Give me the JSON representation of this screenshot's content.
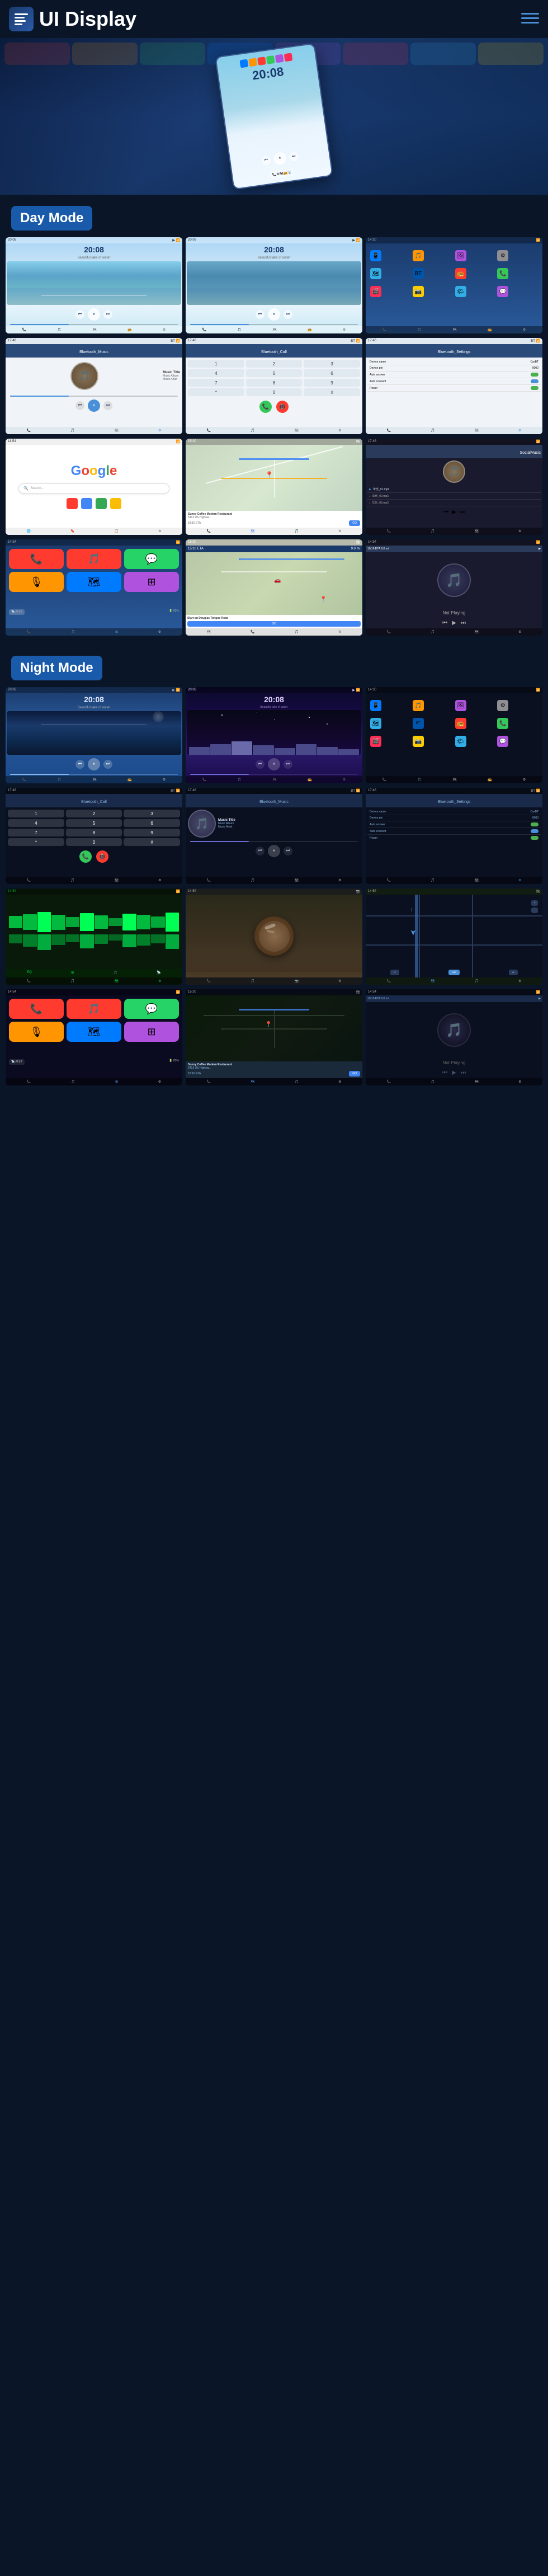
{
  "header": {
    "title": "UI Display",
    "menu_icon": "≡",
    "dots_icon": "⋯"
  },
  "sections": {
    "day_mode": "Day Mode",
    "night_mode": "Night Mode"
  },
  "screens": {
    "music1": {
      "time": "20:08",
      "subtitle": "Beautiful lake of water",
      "track_title": "Music Title",
      "album": "Music Album",
      "artist": "Music Artist"
    },
    "settings": {
      "title": "Bluetooth_Settings",
      "device_name_label": "Device name",
      "device_name_value": "CarBT",
      "device_pin_label": "Device pin",
      "device_pin_value": "0000",
      "auto_answer_label": "Auto answer",
      "auto_connect_label": "Auto connect",
      "power_label": "Power"
    },
    "bluetooth_music": {
      "title": "Bluetooth_Music",
      "track": "Music Title",
      "album": "Music Album",
      "artist": "Music Artist"
    },
    "bluetooth_call": {
      "title": "Bluetooth_Call"
    },
    "navigation": {
      "restaurant": "Sunny Coffee Modern Restaurant",
      "address": "5413 US Highwa...",
      "eta": "18:16 ETA",
      "distance": "9.0 mi",
      "time": "18:16 ETA",
      "start_label": "Start on Douglas Tongue Road"
    },
    "social_music": {
      "title": "SocialMusic",
      "files": [
        "华乐_01.mp3",
        "华乐_02.mp3",
        "华乐_03.mp3"
      ]
    },
    "google": {
      "title": "Google"
    }
  },
  "app_icons": {
    "phone": "📞",
    "music": "🎵",
    "maps": "🗺",
    "settings": "⚙",
    "bt": "🔵",
    "radio": "📻",
    "camera": "📷",
    "gallery": "🖼",
    "messages": "💬",
    "weather": "🌤",
    "browser": "🌐",
    "apps": "⊞"
  },
  "colors": {
    "bg_dark": "#0a1628",
    "accent_blue": "#1a5aaa",
    "card_bg": "#0d1f3c",
    "text_light": "#ffffff",
    "text_muted": "#8ab4e0"
  }
}
